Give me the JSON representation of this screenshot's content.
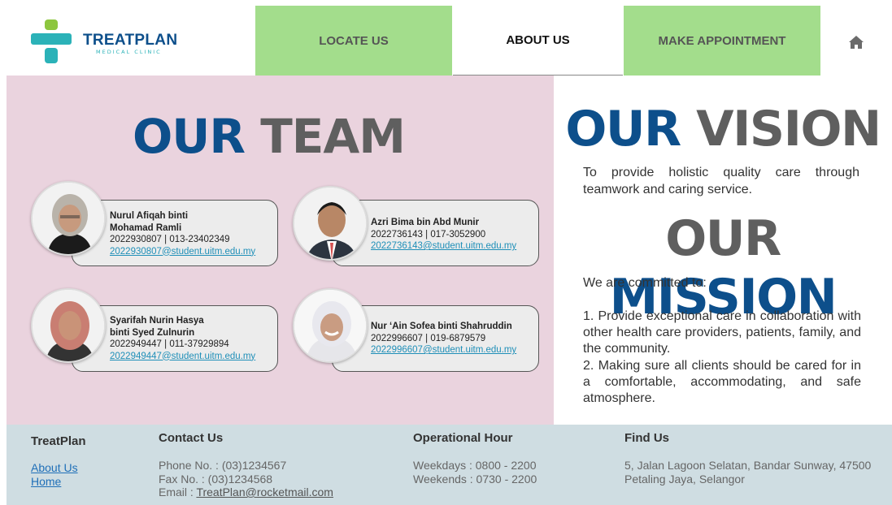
{
  "brand": {
    "name": "TREATPLAN",
    "tagline": "MEDICAL CLINIC",
    "colors": {
      "primary": "#0d4f8b",
      "accent_green": "#a3dd8c",
      "teal": "#2bb2b8",
      "team_bg": "#ead3de",
      "footer_bg": "#cfdde2"
    }
  },
  "nav": {
    "locate": "LOCATE US",
    "about": "ABOUT US",
    "appointment": "MAKE APPOINTMENT",
    "home_icon": "home-icon"
  },
  "team": {
    "title_part1": "OUR",
    "title_part2": "TEAM",
    "members": [
      {
        "name_line1": "Nurul Afiqah binti",
        "name_line2": "Mohamad Ramli",
        "ids": "2022930807 | 013-23402349",
        "email": "2022930807@student.uitm.edu.my"
      },
      {
        "name_line1": "Azri Bima bin Abd Munir",
        "name_line2": "",
        "ids": "2022736143 | 017-3052900",
        "email": "2022736143@student.uitm.edu.my"
      },
      {
        "name_line1": "Syarifah Nurin Hasya",
        "name_line2": "binti Syed Zulnurin",
        "ids": "2022949447 | 011-37929894",
        "email": "2022949447@student.uitm.edu.my"
      },
      {
        "name_line1": "Nur ‘Ain Sofea binti Shahruddin",
        "name_line2": "",
        "ids": "2022996607 | 019-6879579",
        "email": "2022996607@student.uitm.edu.my"
      }
    ]
  },
  "vision": {
    "title_part1": "OUR",
    "title_part2": "VISION",
    "text": "To provide holistic quality care through teamwork and caring service."
  },
  "mission": {
    "title_part1": "OUR",
    "title_part2": "MISSION",
    "intro": "We are committed to:",
    "item1": "1. Provide exceptional care in collaboration with other health care providers, patients, family, and the community.",
    "item2": "2. Making sure all clients should be cared for in a comfortable, accommodating, and safe atmosphere."
  },
  "footer": {
    "brand": "TreatPlan",
    "links": {
      "about": "About Us",
      "home": "Home"
    },
    "contact": {
      "heading": "Contact Us",
      "phone": "Phone No. : (03)1234567",
      "fax": "Fax No. : (03)1234568",
      "email_label": "Email : ",
      "email": "TreatPlan@rocketmail.com"
    },
    "hours": {
      "heading": "Operational Hour",
      "weekdays": "Weekdays : 0800 - 2200",
      "weekends": "Weekends : 0730 - 2200"
    },
    "find": {
      "heading": "Find Us",
      "line1": "5, Jalan Lagoon Selatan, Bandar Sunway, 47500",
      "line2": "Petaling Jaya, Selangor"
    }
  }
}
